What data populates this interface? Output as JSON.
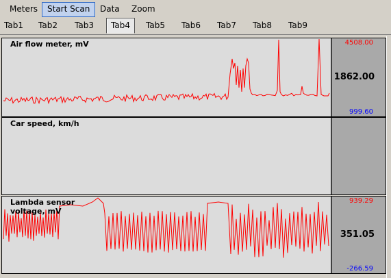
{
  "menu": {
    "items": [
      {
        "label": "Meters"
      },
      {
        "label": "Start Scan",
        "active": true
      },
      {
        "label": "Data"
      },
      {
        "label": "Zoom"
      }
    ]
  },
  "tabs": [
    {
      "label": "Tab1"
    },
    {
      "label": "Tab2"
    },
    {
      "label": "Tab3"
    },
    {
      "label": "Tab4",
      "selected": true
    },
    {
      "label": "Tab5"
    },
    {
      "label": "Tab6"
    },
    {
      "label": "Tab7"
    },
    {
      "label": "Tab8"
    },
    {
      "label": "Tab9"
    }
  ],
  "colors": {
    "trace": "#ff0000",
    "max_text": "#ff0000",
    "min_text": "#0000ff",
    "plot_bg": "#dcdcdc",
    "side_bg": "#a9a9a9"
  },
  "panels": [
    {
      "label": "Air flow meter, mV",
      "max": "4508.00",
      "current": "1862.00",
      "min": "999.60"
    },
    {
      "label": "Car speed, km/h",
      "max": "",
      "current": "",
      "min": ""
    },
    {
      "label": "Lambda sensor voltage, mV",
      "max": "939.29",
      "current": "351.05",
      "min": "-266.59"
    }
  ]
}
